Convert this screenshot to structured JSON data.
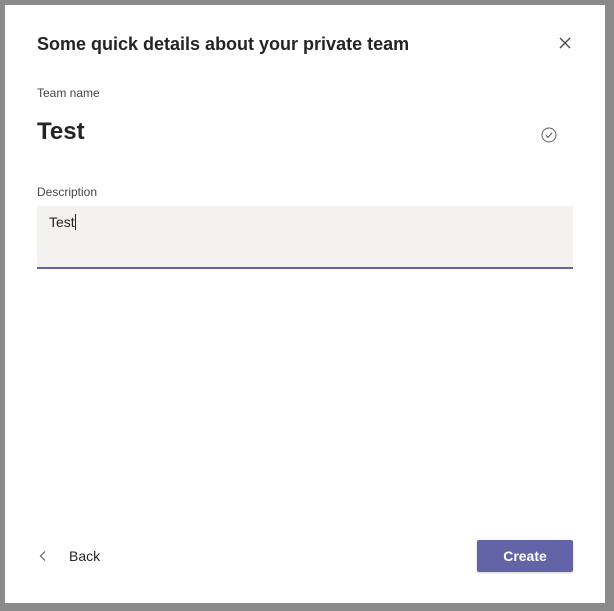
{
  "dialog": {
    "title": "Some quick details about your private team",
    "close_icon": "close-icon"
  },
  "team_name": {
    "label": "Team name",
    "value": "Test",
    "status_icon": "check-circle-icon"
  },
  "description": {
    "label": "Description",
    "value": "Test"
  },
  "footer": {
    "back_label": "Back",
    "back_icon": "chevron-left-icon",
    "create_label": "Create"
  },
  "colors": {
    "accent": "#6264a7",
    "field_bg": "#f3f2f1",
    "text": "#252423"
  }
}
